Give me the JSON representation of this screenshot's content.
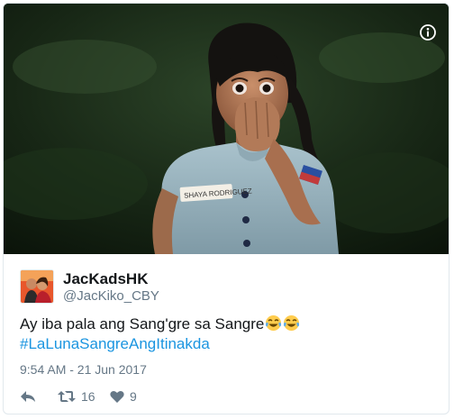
{
  "tweet": {
    "media": {
      "description_icon": "info-icon",
      "image": "photo"
    },
    "author": {
      "display_name": "JacKadsHK",
      "handle": "@JacKiko_CBY"
    },
    "text": "Ay iba pala ang Sang'gre sa Sangre",
    "emojis": [
      "face-with-tears-of-joy",
      "face-with-tears-of-joy"
    ],
    "hashtag": "#LaLunaSangreAngItinakda",
    "timestamp": "9:54 AM - 21 Jun 2017",
    "actions": {
      "reply_icon": "reply-icon",
      "retweet_icon": "retweet-icon",
      "retweet_count": "16",
      "like_icon": "heart-icon",
      "like_count": "9"
    },
    "photo_name_tag": "SHAYA RODRIGUEZ"
  },
  "colors": {
    "hashtag": "#1b95e0",
    "secondary_text": "#657786",
    "primary_text": "#14171a",
    "border": "#e1e8ed"
  }
}
